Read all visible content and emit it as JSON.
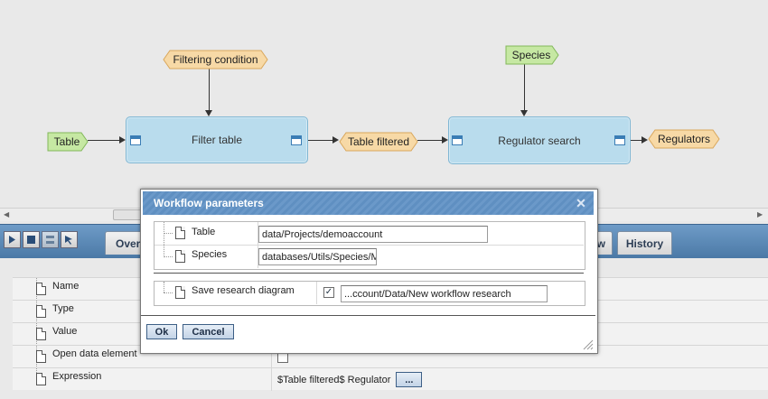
{
  "workflow": {
    "inputs": {
      "table": "Table",
      "filtering_condition": "Filtering condition",
      "species": "Species"
    },
    "steps": {
      "filter_table": "Filter table",
      "regulator_search": "Regulator search"
    },
    "outputs": {
      "table_filtered": "Table filtered",
      "regulators": "Regulators"
    },
    "colors": {
      "input_fill": "#c6e8a3",
      "input_border": "#82b85a",
      "output_fill": "#f7d9a6",
      "output_border": "#d9a75b",
      "step_fill": "#b9dced"
    }
  },
  "tabs": {
    "overview": "Overview",
    "view": "View",
    "history": "History"
  },
  "properties": {
    "rows": [
      {
        "name": "Name",
        "value": ""
      },
      {
        "name": "Type",
        "value": ""
      },
      {
        "name": "Value",
        "value": ""
      },
      {
        "name": "Open data element",
        "value": ""
      },
      {
        "name": "Expression",
        "value": "$Table filtered$ Regulator"
      }
    ],
    "more_button": "..."
  },
  "dialog": {
    "title": "Workflow parameters",
    "close_icon": "close-icon",
    "params": [
      {
        "label": "Table",
        "value": "data/Projects/demoaccount"
      },
      {
        "label": "Species",
        "value": "databases/Utils/Species/M"
      }
    ],
    "save": {
      "label": "Save research diagram",
      "checked": true,
      "value": "...ccount/Data/New workflow research"
    },
    "ok_label": "Ok",
    "cancel_label": "Cancel"
  }
}
